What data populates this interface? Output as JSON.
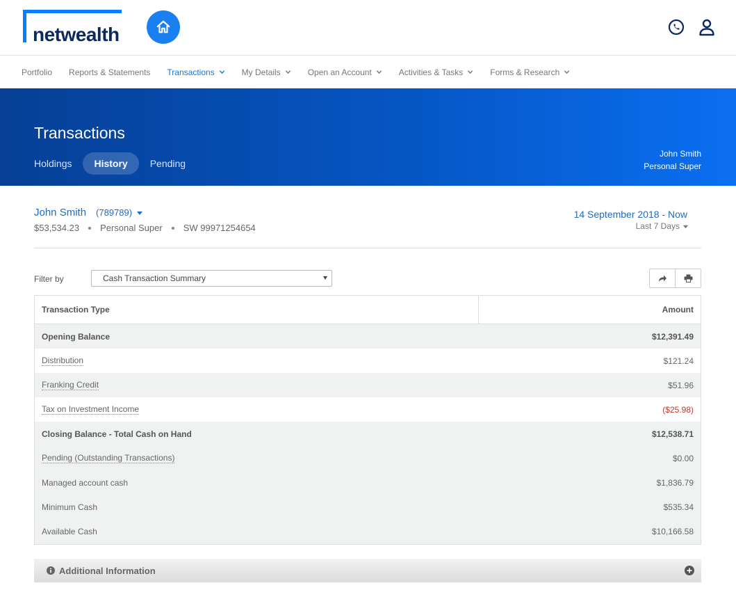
{
  "brand": {
    "name": "netwealth",
    "accent": "#0a7cff",
    "dark": "#0b2a5b"
  },
  "header": {
    "home_icon": "home-icon",
    "phone_icon": "phone-icon",
    "user_icon": "user-icon"
  },
  "nav": {
    "items": [
      {
        "label": "Portfolio",
        "dropdown": false
      },
      {
        "label": "Reports & Statements",
        "dropdown": false
      },
      {
        "label": "Transactions",
        "dropdown": true,
        "active": true
      },
      {
        "label": "My Details",
        "dropdown": true
      },
      {
        "label": "Open an Account",
        "dropdown": true
      },
      {
        "label": "Activities & Tasks",
        "dropdown": true
      },
      {
        "label": "Forms & Research",
        "dropdown": true
      }
    ]
  },
  "banner": {
    "title": "Transactions",
    "tabs": [
      {
        "label": "Holdings",
        "active": false
      },
      {
        "label": "History",
        "active": true
      },
      {
        "label": "Pending",
        "active": false
      }
    ],
    "user_name": "John Smith",
    "account_type": "Personal Super"
  },
  "account": {
    "name": "John Smith",
    "number": "(789789)",
    "balance": "$53,534.23",
    "type": "Personal Super",
    "code": "SW 99971254654"
  },
  "date": {
    "range": "14 September 2018 - Now",
    "preset": "Last 7 Days"
  },
  "filter": {
    "label": "Filter by",
    "value": "Cash Transaction Summary"
  },
  "table": {
    "headers": {
      "type": "Transaction Type",
      "amount": "Amount"
    },
    "rows": [
      {
        "label": "Opening Balance",
        "amount": "$12,391.49",
        "bold": true,
        "link": false,
        "bg": "grey"
      },
      {
        "label": "Distribution",
        "amount": "$121.24",
        "bold": false,
        "link": true,
        "bg": "white"
      },
      {
        "label": "Franking Credit",
        "amount": "$51.96",
        "bold": false,
        "link": true,
        "bg": "grey"
      },
      {
        "label": "Tax on Investment Income",
        "amount": "($25.98)",
        "bold": false,
        "link": true,
        "bg": "white",
        "negative": true
      },
      {
        "label": "Closing Balance - Total Cash on Hand",
        "amount": "$12,538.71",
        "bold": true,
        "link": false,
        "bg": "grey"
      },
      {
        "label": "Pending (Outstanding Transactions)",
        "amount": "$0.00",
        "bold": false,
        "link": true,
        "bg": "grey"
      },
      {
        "label": "Managed account cash",
        "amount": "$1,836.79",
        "bold": false,
        "link": false,
        "bg": "grey"
      },
      {
        "label": "Minimum Cash",
        "amount": "$535.34",
        "bold": false,
        "link": false,
        "bg": "grey"
      },
      {
        "label": "Available Cash",
        "amount": "$10,166.58",
        "bold": false,
        "link": false,
        "bg": "grey"
      }
    ]
  },
  "additional": {
    "label": "Additional Information"
  }
}
